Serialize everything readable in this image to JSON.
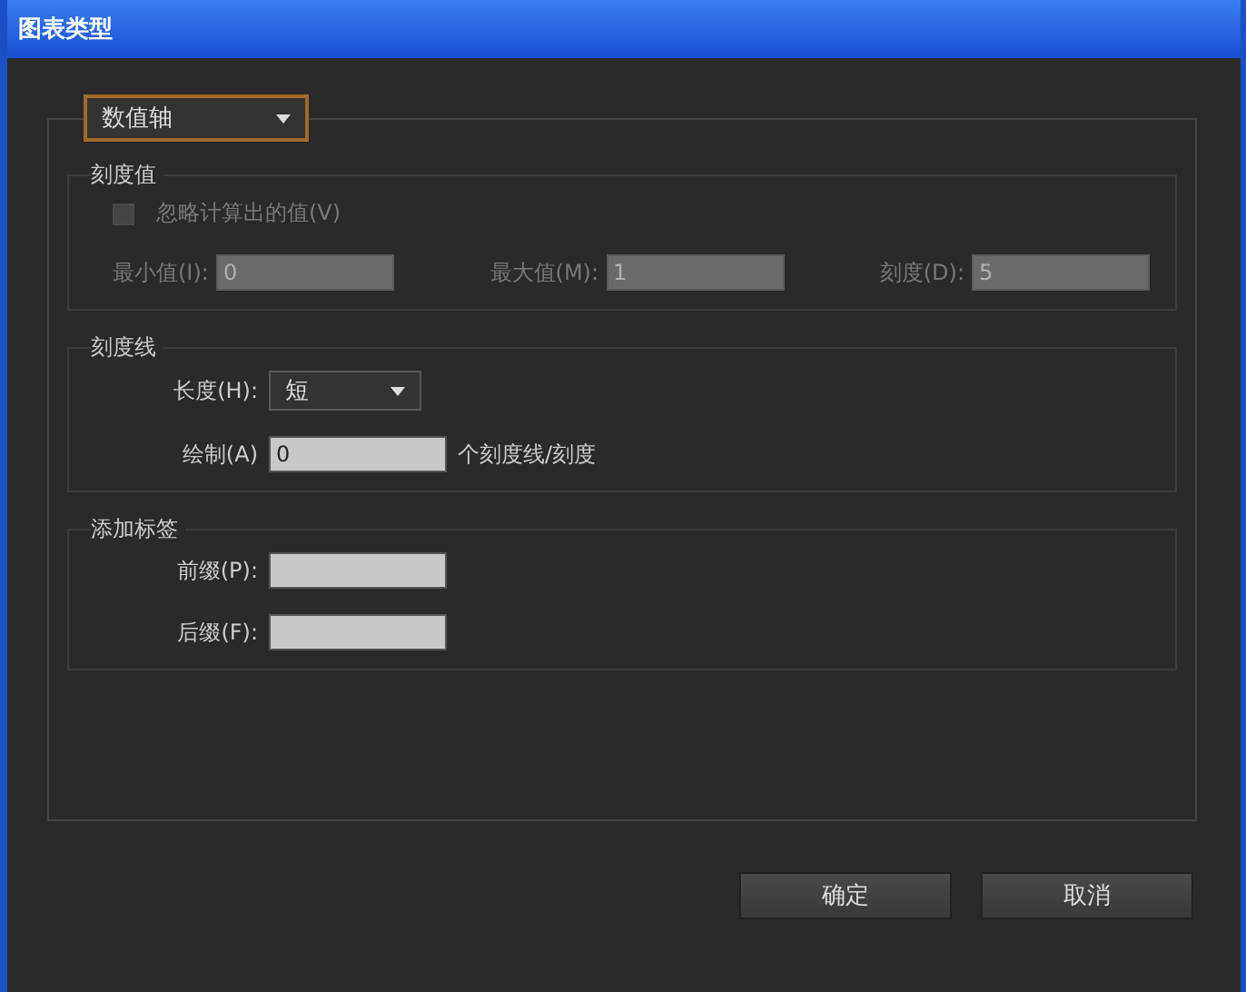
{
  "window": {
    "title": "图表类型"
  },
  "axis_dropdown": {
    "value": "数值轴"
  },
  "groups": [
    {
      "title": "刻度值",
      "rows": [
        {
          "kind": "checkbox",
          "label": "忽略计算出的值(V)",
          "checked": false,
          "disabled": true
        },
        {
          "kind": "fields",
          "fields": [
            {
              "label": "最小值(I):",
              "value": "0",
              "disabled": true
            },
            {
              "label": "最大值(M):",
              "value": "1",
              "disabled": true
            },
            {
              "label": "刻度(D):",
              "value": "5",
              "disabled": true
            }
          ]
        }
      ]
    },
    {
      "title": "刻度线",
      "rows": [
        {
          "kind": "dropdown",
          "label": "长度(H):",
          "value": "短"
        },
        {
          "kind": "field",
          "label": "绘制(A)",
          "value": "0",
          "disabled": false,
          "suffix": "个刻度线/刻度"
        }
      ]
    },
    {
      "title": "添加标签",
      "rows": [
        {
          "kind": "field",
          "label": "前缀(P):",
          "value": "",
          "disabled": false
        },
        {
          "kind": "field",
          "label": "后缀(F):",
          "value": "",
          "disabled": false
        }
      ]
    }
  ],
  "buttons": [
    "确定",
    "取消"
  ]
}
